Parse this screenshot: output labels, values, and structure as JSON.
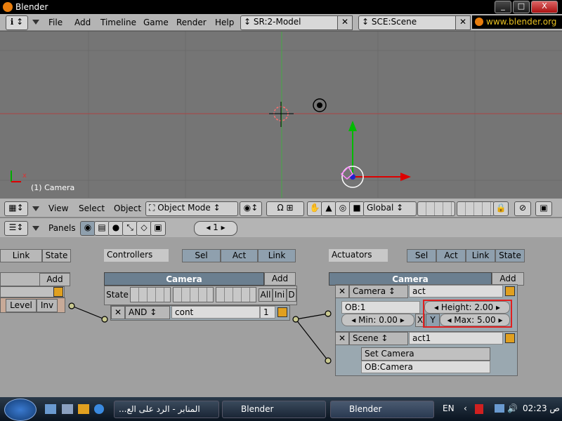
{
  "window": {
    "title": "Blender",
    "min": "_",
    "max": "□",
    "close": "X"
  },
  "menubar": {
    "items": [
      "File",
      "Add",
      "Timeline",
      "Game",
      "Render",
      "Help"
    ],
    "screen": "SR:2-Model",
    "scene": "SCE:Scene",
    "site": "www.blender.org 2"
  },
  "viewport": {
    "object_label": "(1) Camera",
    "axis_x": "x"
  },
  "view_header": {
    "menus": [
      "View",
      "Select",
      "Object"
    ],
    "mode": "Object Mode",
    "orientation": "Global"
  },
  "panels_header": {
    "label": "Panels",
    "page": "1"
  },
  "left_col": {
    "link": "Link",
    "state": "State",
    "add": "Add",
    "level": "Level",
    "inv": "Inv"
  },
  "controllers": {
    "label": "Controllers",
    "sel": "Sel",
    "act": "Act",
    "link": "Link",
    "object": "Camera",
    "add": "Add",
    "state": "State",
    "all": "All",
    "ini": "Ini",
    "d": "D",
    "type": "AND",
    "name": "cont",
    "priority": "1"
  },
  "actuators": {
    "label": "Actuators",
    "sel": "Sel",
    "act": "Act",
    "link": "Link",
    "state": "State",
    "object": "Camera",
    "add": "Add",
    "camera_act": {
      "type": "Camera",
      "name": "act",
      "ob": "OB:1",
      "height": "Height: 2.00",
      "min": "Min: 0.00",
      "max": "Max: 5.00",
      "x": "X",
      "y": "Y"
    },
    "scene_act": {
      "type": "Scene",
      "name": "act1",
      "mode": "Set Camera",
      "ob": "OB:Camera"
    }
  },
  "taskbar": {
    "tasks": [
      "المنابر - الرد على الع...",
      "Blender",
      "Blender"
    ],
    "lang": "EN",
    "clock": "02:23 ص"
  },
  "colors": {
    "highlight_box": "#e02020",
    "viewport_bg": "#757575",
    "grid_line": "#6a6a6a"
  }
}
